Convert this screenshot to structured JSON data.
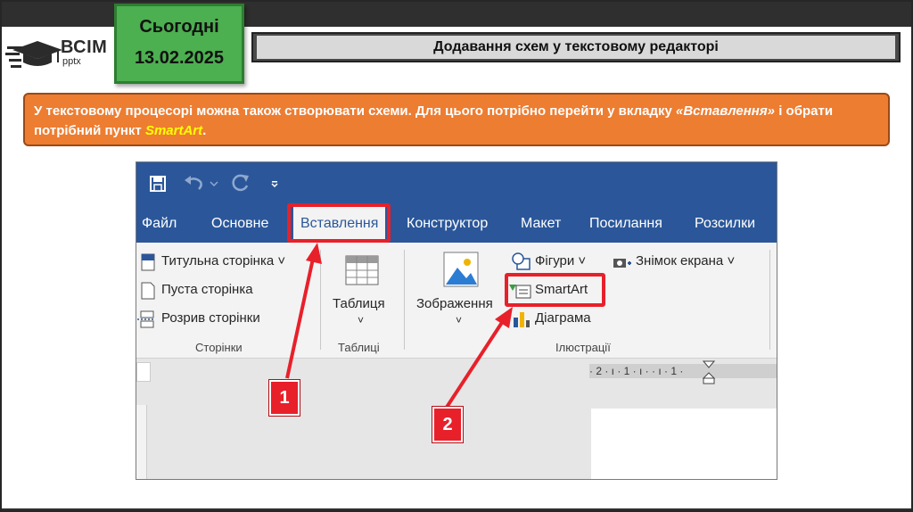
{
  "logo": {
    "brand": "ВСІМ",
    "sub": "pptx"
  },
  "date_badge": {
    "label": "Сьогодні",
    "date": "13.02.2025"
  },
  "title": "Додавання схем у текстовому редакторі",
  "instruction": {
    "part1": "У текстовому процесорі можна також створювати схеми. Для цього потрібно перейти у вкладку ",
    "tab_name": "«Вставлення»",
    "part2": " і обрати потрібний пункт ",
    "item_name": "SmartArt",
    "part3": "."
  },
  "word": {
    "tabs": [
      "Файл",
      "Основне",
      "Вставлення",
      "Конструктор",
      "Макет",
      "Посилання",
      "Розсилки"
    ],
    "pages_group": {
      "items": [
        "Титульна сторінка",
        "Пуста сторінка",
        "Розрив сторінки"
      ],
      "label": "Сторінки"
    },
    "tables_group": {
      "button": "Таблиця",
      "label": "Таблиці"
    },
    "illustrations_group": {
      "image_button": "Зображення",
      "shapes": "Фігури",
      "smartart": "SmartArt",
      "chart": "Діаграма",
      "screenshot": "Знімок екрана",
      "label": "Ілюстрації"
    },
    "ruler_text": "· 2 · ı · 1 · ı ·     · ı · 1 ·"
  },
  "callouts": [
    "1",
    "2"
  ],
  "colors": {
    "word_blue": "#2b579a",
    "highlight_red": "#e8202a",
    "instruction_orange": "#ed7d31",
    "date_green": "#4caf50",
    "smartart_yellow": "#ffff00"
  }
}
